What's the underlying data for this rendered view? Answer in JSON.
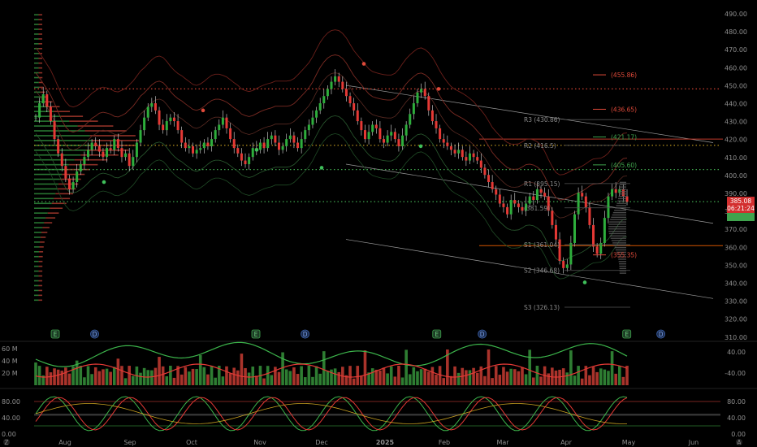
{
  "chart_data": {
    "type": "candlestick",
    "x_ticks": [
      "Aug",
      "Sep",
      "Oct",
      "Nov",
      "Dec",
      "2025",
      "Feb",
      "Mar",
      "Apr",
      "May",
      "Jun"
    ],
    "y_ticks": [
      "490.00",
      "480.00",
      "470.00",
      "460.00",
      "450.00",
      "440.00",
      "430.00",
      "420.00",
      "410.00",
      "400.00",
      "390.00",
      "380.00",
      "370.00",
      "360.00",
      "350.00",
      "340.00",
      "330.00",
      "320.00",
      "310.00"
    ],
    "ylim": [
      308,
      494
    ],
    "price_tag": {
      "price": "385.08",
      "timer": "06:21:24",
      "value": 385.08
    },
    "green_tag": {
      "value": 376.5
    },
    "pivots": [
      {
        "label": "R3 (430.86)",
        "value": 430.86,
        "color": "#8a8a8a"
      },
      {
        "label": "R2 (416.5)",
        "value": 416.5,
        "color": "#8a8a8a"
      },
      {
        "label": "R1 (395.15)",
        "value": 395.15,
        "color": "#8a8a8a"
      },
      {
        "label": "(381.59)",
        "value": 381.59,
        "color": "#8a8a8a"
      },
      {
        "label": "S1 (361.04)",
        "value": 361.04,
        "color": "#8a8a8a"
      },
      {
        "label": "S2 (346.68)",
        "value": 346.68,
        "color": "#8a8a8a"
      },
      {
        "label": "S3 (326.13)",
        "value": 326.13,
        "color": "#8a8a8a"
      }
    ],
    "targets": [
      {
        "label": "(455.86)",
        "value": 455.86,
        "color": "#e04a3a"
      },
      {
        "label": "(436.65)",
        "value": 436.65,
        "color": "#e04a3a"
      },
      {
        "label": "(421.17)",
        "value": 421.17,
        "color": "#3fa34d"
      },
      {
        "label": "(405.60)",
        "value": 405.6,
        "color": "#3fa34d"
      },
      {
        "label": "(355.35)",
        "value": 355.35,
        "color": "#e04a3a"
      }
    ],
    "dotted_levels": [
      {
        "value": 448,
        "color": "#d04030"
      },
      {
        "value": 416.5,
        "color": "#c8a020"
      },
      {
        "value": 403,
        "color": "#3fa34d"
      },
      {
        "value": 385.08,
        "color": "#3fa34d"
      }
    ],
    "hlines": [
      {
        "value": 420,
        "color": "#c0392b"
      },
      {
        "value": 360.5,
        "color": "#d35400"
      }
    ],
    "close_series": [
      432,
      440,
      445,
      438,
      430,
      420,
      412,
      405,
      398,
      392,
      396,
      402,
      406,
      410,
      414,
      418,
      416,
      413,
      410,
      415,
      414,
      420,
      415,
      410,
      412,
      405,
      410,
      418,
      425,
      432,
      438,
      440,
      436,
      428,
      425,
      430,
      432,
      430,
      425,
      418,
      415,
      416,
      412,
      414,
      415,
      418,
      416,
      420,
      425,
      428,
      432,
      426,
      420,
      415,
      412,
      408,
      406,
      410,
      415,
      414,
      418,
      415,
      420,
      422,
      418,
      414,
      416,
      420,
      422,
      418,
      415,
      420,
      425,
      428,
      432,
      436,
      440,
      444,
      448,
      452,
      455,
      452,
      448,
      444,
      440,
      436,
      430,
      425,
      420,
      424,
      428,
      426,
      420,
      418,
      422,
      424,
      420,
      416,
      422,
      428,
      434,
      440,
      446,
      448,
      444,
      436,
      430,
      426,
      420,
      418,
      416,
      414,
      412,
      414,
      410,
      408,
      412,
      410,
      408,
      404,
      400,
      396,
      392,
      389,
      384,
      382,
      378,
      386,
      384,
      382,
      380,
      384,
      388,
      386,
      392,
      390,
      388,
      380,
      372,
      364,
      352,
      348,
      350,
      362,
      378,
      390,
      388,
      382,
      372,
      360,
      356,
      362,
      376,
      388,
      392,
      390,
      392,
      388,
      385
    ],
    "volume_axis": [
      "60 M",
      "40 M",
      "20 M"
    ],
    "volume_right": [
      "40.00",
      "-40.00"
    ],
    "osc_axis": [
      "80.00",
      "40.00",
      "0.00"
    ],
    "osc_right": [
      "80.00",
      "40.00",
      "0.00"
    ],
    "osc_bands": [
      80,
      50,
      45,
      20
    ],
    "events": {
      "earnings_label": "E",
      "dividend_label": "D",
      "earnings_marks": [
        {
          "x": 0.073
        },
        {
          "x": 0.338
        },
        {
          "x": 0.577
        },
        {
          "x": 0.828
        }
      ],
      "dividend_marks": [
        {
          "x": 0.125
        },
        {
          "x": 0.403
        },
        {
          "x": 0.637
        },
        {
          "x": 0.873
        }
      ]
    }
  },
  "footer": {
    "left_icon": "Z",
    "right_icon": "A"
  }
}
